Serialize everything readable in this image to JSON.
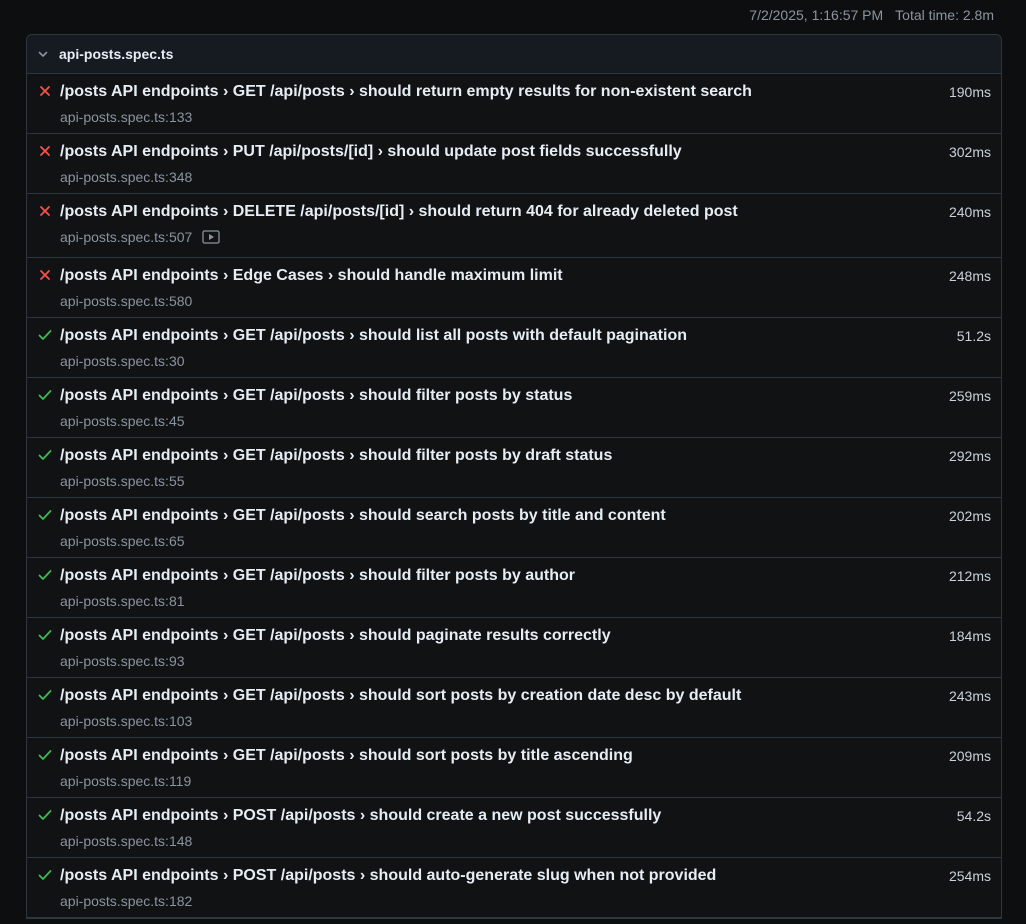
{
  "header": {
    "timestamp": "7/2/2025, 1:16:57 PM",
    "total_time": "Total time: 2.8m"
  },
  "file": {
    "name": "api-posts.spec.ts",
    "expanded_icon": "chevron-down-icon"
  },
  "tests": [
    {
      "status": "failed",
      "title": "/posts API endpoints › GET /api/posts › should return empty results for non-existent search",
      "location": "api-posts.spec.ts:133",
      "duration": "190ms",
      "has_video": false
    },
    {
      "status": "failed",
      "title": "/posts API endpoints › PUT /api/posts/[id] › should update post fields successfully",
      "location": "api-posts.spec.ts:348",
      "duration": "302ms",
      "has_video": false
    },
    {
      "status": "failed",
      "title": "/posts API endpoints › DELETE /api/posts/[id] › should return 404 for already deleted post",
      "location": "api-posts.spec.ts:507",
      "duration": "240ms",
      "has_video": true
    },
    {
      "status": "failed",
      "title": "/posts API endpoints › Edge Cases › should handle maximum limit",
      "location": "api-posts.spec.ts:580",
      "duration": "248ms",
      "has_video": false
    },
    {
      "status": "passed",
      "title": "/posts API endpoints › GET /api/posts › should list all posts with default pagination",
      "location": "api-posts.spec.ts:30",
      "duration": "51.2s",
      "has_video": false
    },
    {
      "status": "passed",
      "title": "/posts API endpoints › GET /api/posts › should filter posts by status",
      "location": "api-posts.spec.ts:45",
      "duration": "259ms",
      "has_video": false
    },
    {
      "status": "passed",
      "title": "/posts API endpoints › GET /api/posts › should filter posts by draft status",
      "location": "api-posts.spec.ts:55",
      "duration": "292ms",
      "has_video": false
    },
    {
      "status": "passed",
      "title": "/posts API endpoints › GET /api/posts › should search posts by title and content",
      "location": "api-posts.spec.ts:65",
      "duration": "202ms",
      "has_video": false
    },
    {
      "status": "passed",
      "title": "/posts API endpoints › GET /api/posts › should filter posts by author",
      "location": "api-posts.spec.ts:81",
      "duration": "212ms",
      "has_video": false
    },
    {
      "status": "passed",
      "title": "/posts API endpoints › GET /api/posts › should paginate results correctly",
      "location": "api-posts.spec.ts:93",
      "duration": "184ms",
      "has_video": false
    },
    {
      "status": "passed",
      "title": "/posts API endpoints › GET /api/posts › should sort posts by creation date desc by default",
      "location": "api-posts.spec.ts:103",
      "duration": "243ms",
      "has_video": false
    },
    {
      "status": "passed",
      "title": "/posts API endpoints › GET /api/posts › should sort posts by title ascending",
      "location": "api-posts.spec.ts:119",
      "duration": "209ms",
      "has_video": false
    },
    {
      "status": "passed",
      "title": "/posts API endpoints › POST /api/posts › should create a new post successfully",
      "location": "api-posts.spec.ts:148",
      "duration": "54.2s",
      "has_video": false
    },
    {
      "status": "passed",
      "title": "/posts API endpoints › POST /api/posts › should auto-generate slug when not provided",
      "location": "api-posts.spec.ts:182",
      "duration": "254ms",
      "has_video": false
    }
  ],
  "colors": {
    "failed": "#f85149",
    "passed": "#3fb950",
    "background": "#0d0e10",
    "row_background": "#111214",
    "border": "#30363d"
  },
  "icons": {
    "failed": "x-icon",
    "passed": "check-icon",
    "video": "video-icon"
  }
}
